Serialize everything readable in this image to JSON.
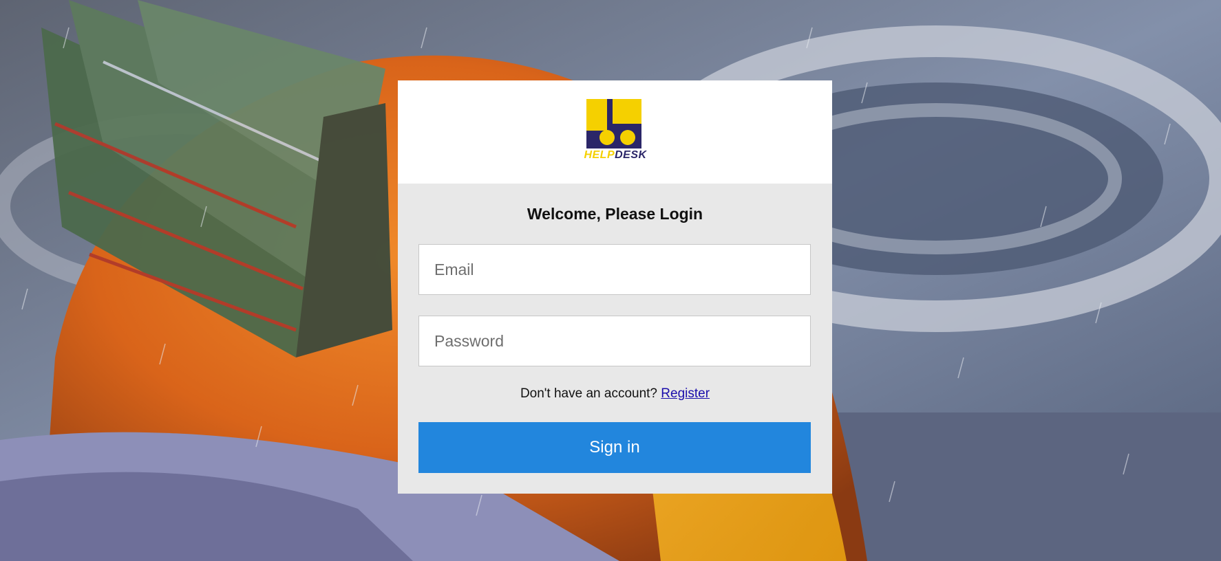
{
  "background": {
    "icon": "hard-hat-rain-photo"
  },
  "logo": {
    "icon": "pu-logo-icon",
    "word_part1": "HELP",
    "word_part2": "DESK",
    "colors": {
      "yellow": "#f5d000",
      "navy": "#2b2668"
    }
  },
  "login": {
    "title": "Welcome, Please Login",
    "email_placeholder": "Email",
    "email_value": "",
    "password_placeholder": "Password",
    "password_value": "",
    "register_prompt": "Don't have an account?",
    "register_link": "Register",
    "signin_label": "Sign in"
  },
  "colors": {
    "card_bg": "#e8e8e8",
    "header_bg": "#ffffff",
    "button_bg": "#2286dd",
    "link": "#1a0dab"
  }
}
